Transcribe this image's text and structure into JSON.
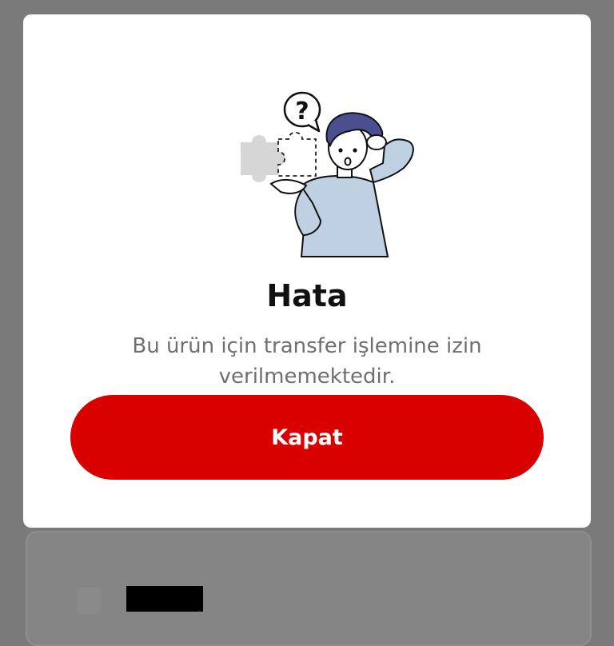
{
  "dialog": {
    "title": "Hata",
    "message": "Bu ürün için transfer işlemine izin verilmemektedir.",
    "close_label": "Kapat",
    "illustration_icon": "confused-person-puzzle-icon"
  },
  "colors": {
    "primary_button": "#d90000",
    "overlay": "#7a7a7a",
    "dialog_background": "#ffffff",
    "title_text": "#111111",
    "message_text": "#6f6f6f"
  }
}
